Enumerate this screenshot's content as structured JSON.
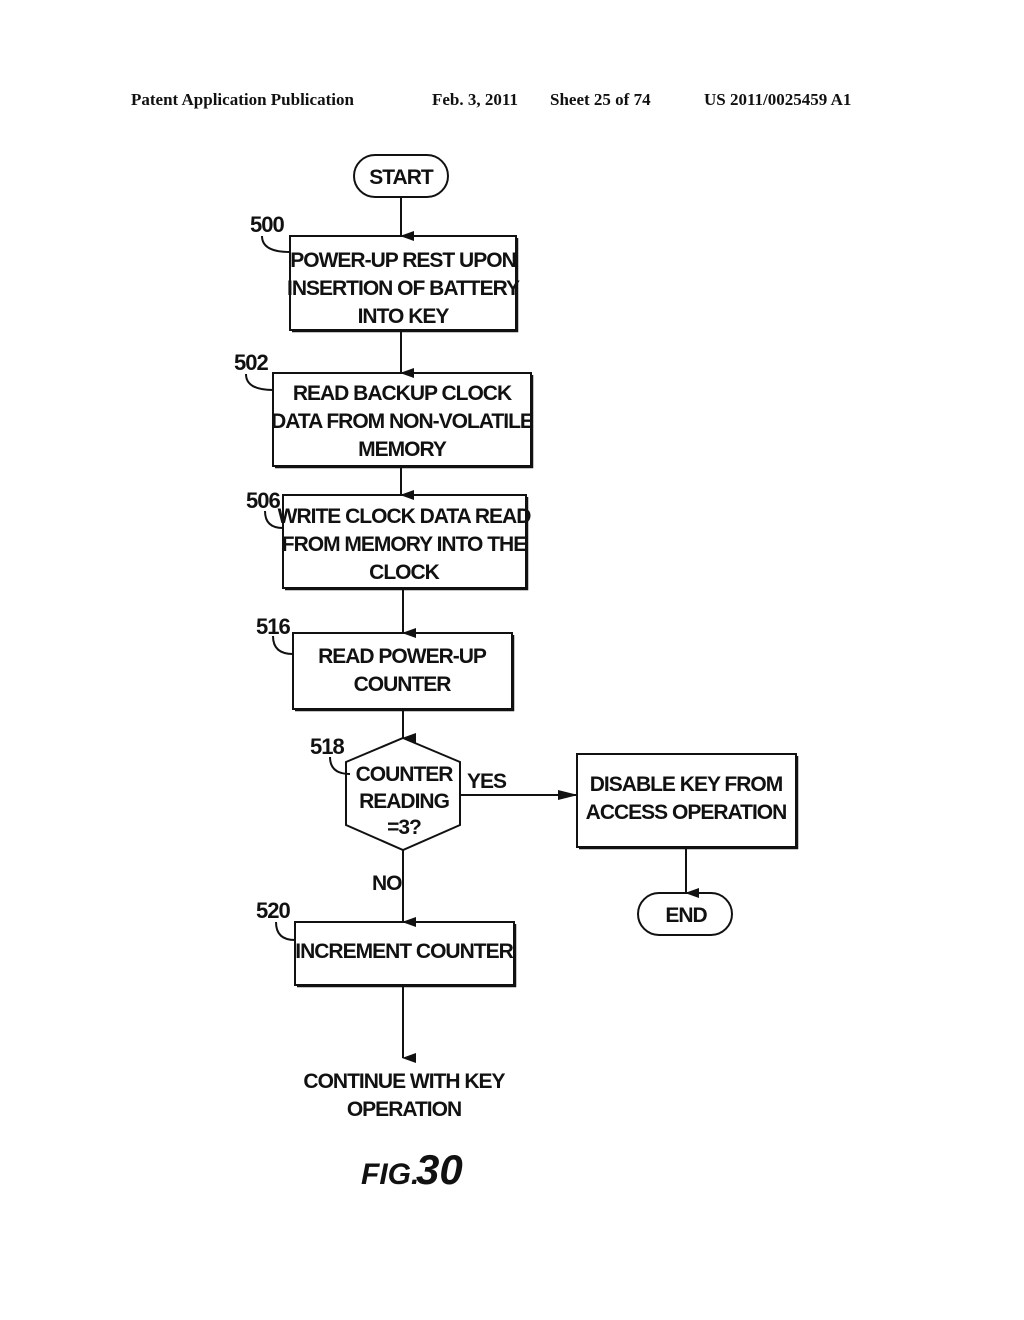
{
  "header": {
    "publication": "Patent Application Publication",
    "date": "Feb. 3, 2011",
    "sheet": "Sheet 25 of 74",
    "number": "US 2011/0025459 A1"
  },
  "flowchart": {
    "start": "START",
    "end": "END",
    "steps": [
      {
        "ref": "500",
        "lines": [
          "POWER-UP REST UPON",
          "INSERTION OF BATTERY",
          "INTO KEY"
        ]
      },
      {
        "ref": "502",
        "lines": [
          "READ BACKUP CLOCK",
          "DATA FROM NON-VOLATILE",
          "MEMORY"
        ]
      },
      {
        "ref": "506",
        "lines": [
          "WRITE CLOCK DATA READ",
          "FROM MEMORY INTO THE",
          "CLOCK"
        ]
      },
      {
        "ref": "516",
        "lines": [
          "READ POWER-UP",
          "COUNTER"
        ]
      }
    ],
    "decision": {
      "ref": "518",
      "lines": [
        "COUNTER",
        "READING",
        "=3?"
      ],
      "yes": "YES",
      "no": "NO"
    },
    "disable": {
      "lines": [
        "DISABLE KEY FROM",
        "ACCESS OPERATION"
      ]
    },
    "increment": {
      "ref": "520",
      "lines": [
        "INCREMENT COUNTER"
      ]
    },
    "continue": {
      "lines": [
        "CONTINUE WITH KEY",
        "OPERATION"
      ]
    }
  },
  "figure": {
    "prefix": "FIG.",
    "number": "30"
  }
}
